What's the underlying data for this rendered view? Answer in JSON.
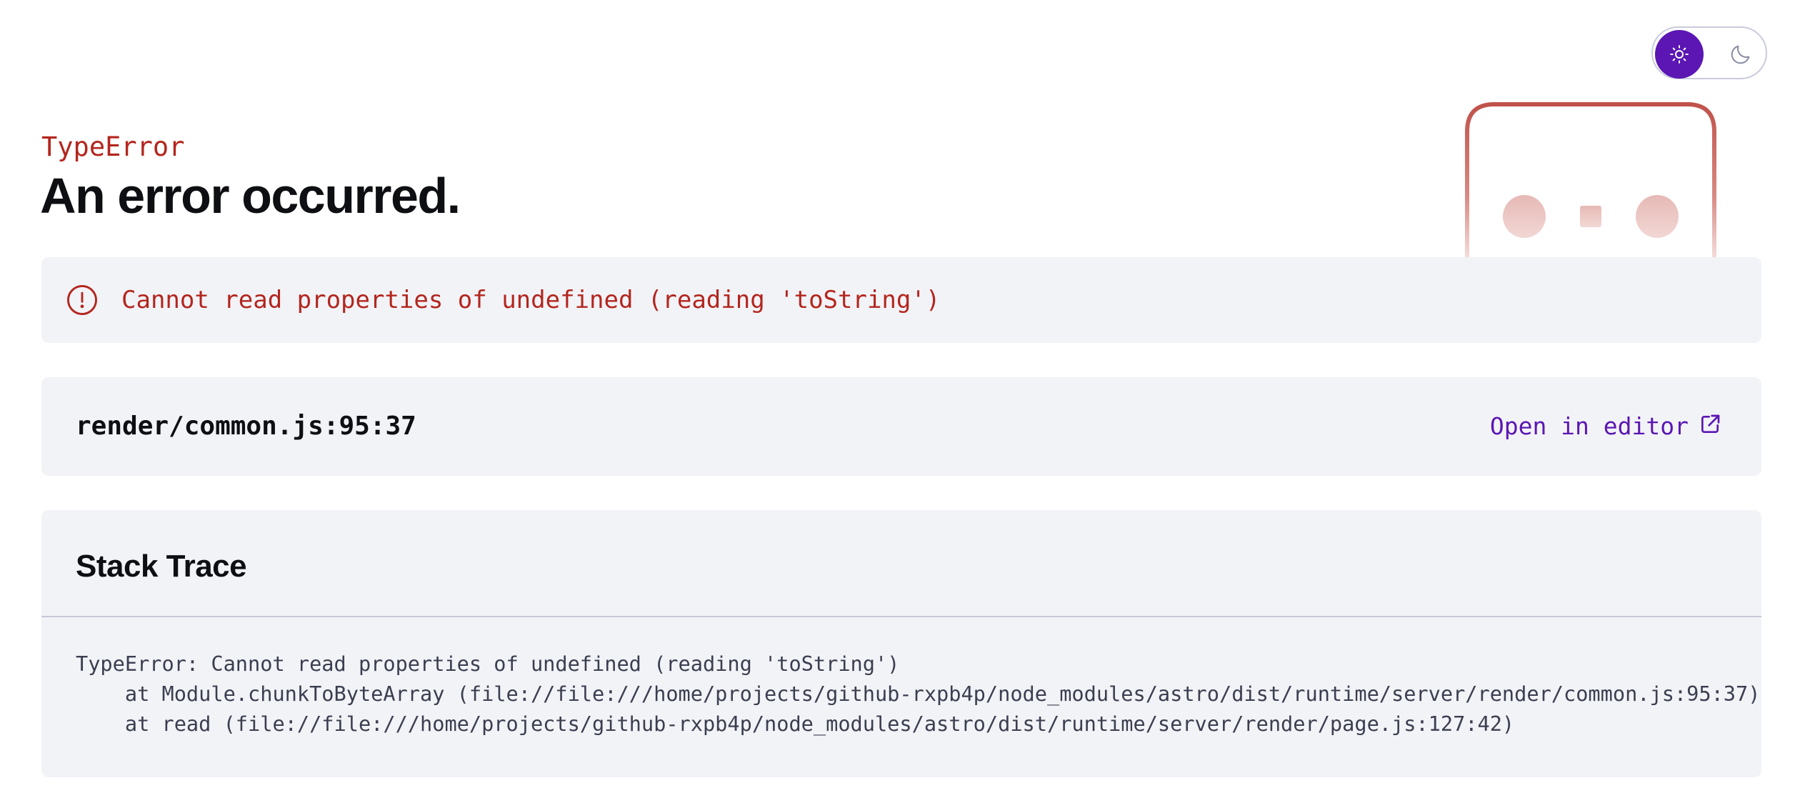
{
  "theme_toggle": {
    "light_icon": "sun-icon",
    "dark_icon": "moon-icon",
    "active": "light",
    "accent_color": "#5b16b3"
  },
  "mascot": {
    "icon": "error-mascot-icon",
    "stroke_color": "#c0524a"
  },
  "error": {
    "name": "TypeError",
    "title": "An error occurred.",
    "message": "Cannot read properties of undefined (reading 'toString')",
    "message_icon": "alert-circle-icon",
    "color": "#b3261e"
  },
  "location": {
    "file": "render/common.js:95:37",
    "open_editor_label": "Open in editor",
    "open_editor_icon": "external-link-icon"
  },
  "stack_trace": {
    "heading": "Stack Trace",
    "lines": [
      "TypeError: Cannot read properties of undefined (reading 'toString')",
      "    at Module.chunkToByteArray (file://file:///home/projects/github-rxpb4p/node_modules/astro/dist/runtime/server/render/common.js:95:37)",
      "    at read (file://file:///home/projects/github-rxpb4p/node_modules/astro/dist/runtime/server/render/page.js:127:42)"
    ]
  }
}
